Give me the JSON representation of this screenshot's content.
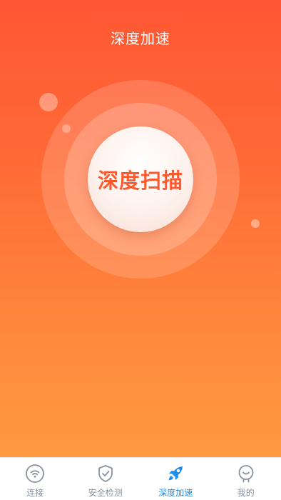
{
  "header": {
    "title": "深度加速"
  },
  "main": {
    "scan_button_label": "深度扫描"
  },
  "tabbar": {
    "tabs": [
      {
        "label": "连接",
        "icon": "wifi-icon",
        "active": false
      },
      {
        "label": "安全检测",
        "icon": "shield-check-icon",
        "active": false
      },
      {
        "label": "深度加速",
        "icon": "rocket-icon",
        "active": true
      },
      {
        "label": "我的",
        "icon": "user-icon",
        "active": false
      }
    ]
  },
  "colors": {
    "gradient_top": "#ff5633",
    "gradient_bottom": "#ff9a40",
    "scan_text": "#ff5a2e",
    "tab_active": "#1e8ef0",
    "tab_inactive": "#8a93a0"
  }
}
